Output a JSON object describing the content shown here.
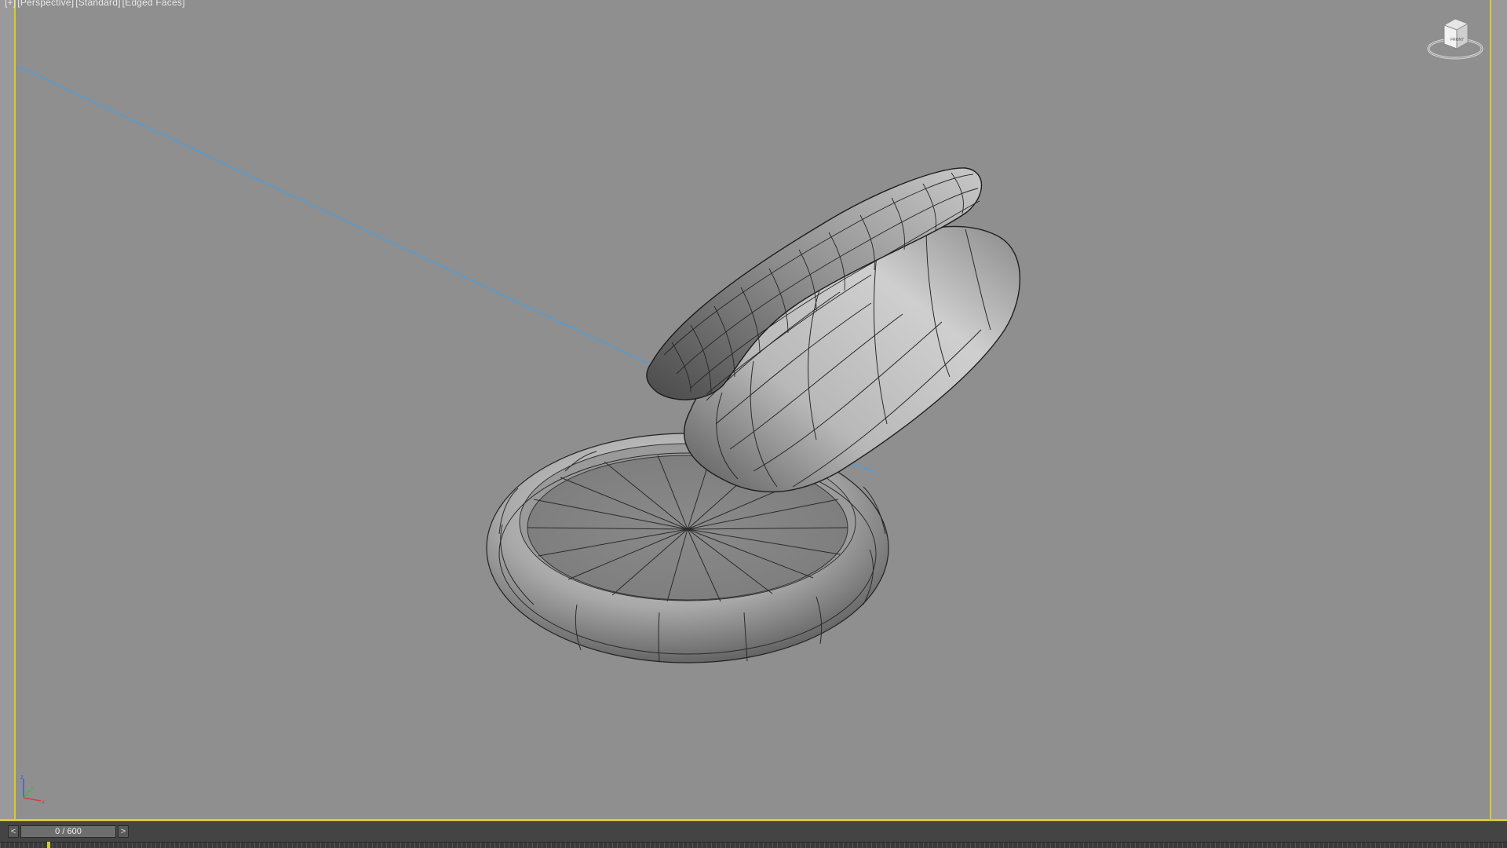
{
  "viewport": {
    "labels": [
      "[+]",
      "[Perspective]",
      "[Standard]",
      "[Edged Faces]"
    ],
    "viewcube_face": "FRONT",
    "axis": {
      "z": "z",
      "y": "y",
      "x": "x"
    }
  },
  "timeline": {
    "prev_label": "<",
    "next_label": ">",
    "frame_display": "0 / 600",
    "current_frame": 0,
    "total_frames": 600
  },
  "colors": {
    "viewport_bg": "#8f8f8f",
    "active_border": "#d6cc2b",
    "ray_line": "#4a9fe0",
    "mesh_dark": "#3c3c3c",
    "mesh_mid": "#8a8a8a",
    "mesh_light": "#cfcfcf"
  },
  "icons": [
    "viewcube-icon",
    "axis-tripod-icon",
    "chevron-left-icon",
    "chevron-right-icon"
  ]
}
